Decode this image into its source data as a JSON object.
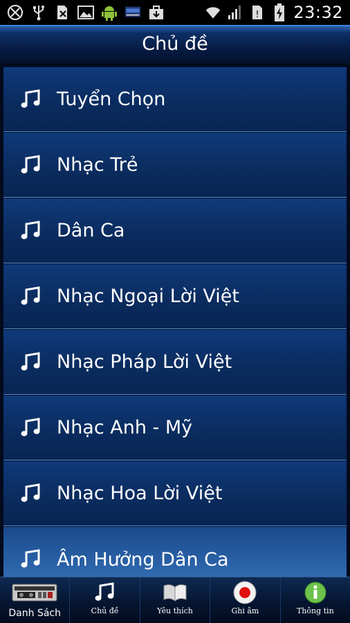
{
  "status_bar": {
    "time": "23:32",
    "left_icons": [
      "sync-off-icon",
      "usb-icon",
      "sd-card-icon",
      "image-icon",
      "android-debug-icon",
      "video-app-icon",
      "download-bag-icon"
    ],
    "right_icons": [
      "wifi-icon",
      "signal-icon",
      "no-sim-icon",
      "battery-charging-icon"
    ]
  },
  "header": {
    "title": "Chủ đề"
  },
  "list": {
    "items": [
      {
        "label": "Tuyển Chọn",
        "icon": "music-note-icon"
      },
      {
        "label": "Nhạc Trẻ",
        "icon": "music-note-icon"
      },
      {
        "label": "Dân Ca",
        "icon": "music-note-icon"
      },
      {
        "label": "Nhạc Ngoại Lời Việt",
        "icon": "music-note-icon"
      },
      {
        "label": "Nhạc Pháp Lời Việt",
        "icon": "music-note-icon"
      },
      {
        "label": "Nhạc Anh - Mỹ",
        "icon": "music-note-icon"
      },
      {
        "label": "Nhạc Hoa Lời Việt",
        "icon": "music-note-icon"
      },
      {
        "label": "Âm Hưởng Dân Ca",
        "icon": "music-note-icon"
      }
    ]
  },
  "tabbar": {
    "tabs": [
      {
        "label": "Danh Sách",
        "icon": "cassette-player-icon"
      },
      {
        "label": "Chủ đề",
        "icon": "music-note-icon"
      },
      {
        "label": "Yêu thích",
        "icon": "book-icon"
      },
      {
        "label": "Ghi âm",
        "icon": "record-icon"
      },
      {
        "label": "Thông tin",
        "icon": "info-icon"
      }
    ]
  },
  "colors": {
    "header_accent": "#3c86e0",
    "list_bg": "#0b2c5f",
    "divider": "#5b8fd0",
    "record_red": "#e01010",
    "info_green": "#6cc24a"
  }
}
